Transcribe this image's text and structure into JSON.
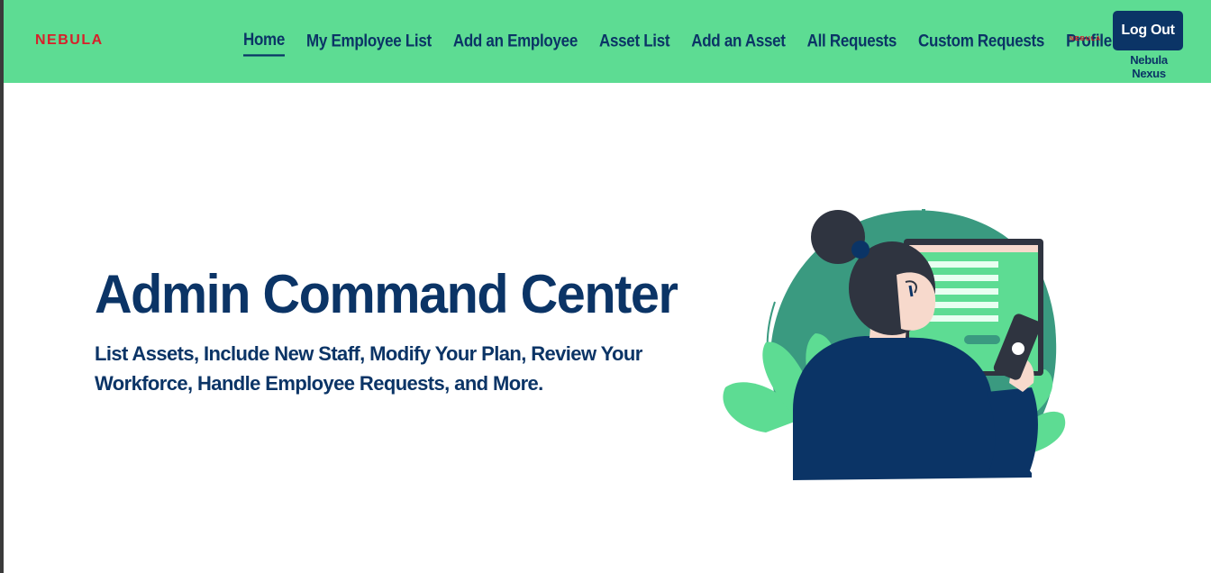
{
  "navbar": {
    "brand": "NEBULA",
    "links": [
      {
        "label": "Home",
        "active": true
      },
      {
        "label": "My Employee List",
        "active": false
      },
      {
        "label": "Add an Employee",
        "active": false
      },
      {
        "label": "Asset List",
        "active": false
      },
      {
        "label": "Add an Asset",
        "active": false
      },
      {
        "label": "All Requests",
        "active": false
      },
      {
        "label": "Custom Requests",
        "active": false
      },
      {
        "label": "Profile",
        "active": false
      }
    ],
    "mini_logo": "NEBULA",
    "logout_label": "Log Out",
    "company_name": "Nebula Nexus"
  },
  "hero": {
    "title": "Admin Command Center",
    "subtitle": "List Assets, Include New Staff, Modify Your Plan, Review Your Workforce, Handle Employee Requests, and More."
  },
  "colors": {
    "navbar_bg": "#5ddc93",
    "brand_red": "#d81f2a",
    "navy": "#0b3466",
    "illustration_teal": "#3a9a80",
    "illustration_green": "#5ddc93"
  },
  "icons": {
    "illustration": "woman-at-computer-on-phone-illustration"
  }
}
